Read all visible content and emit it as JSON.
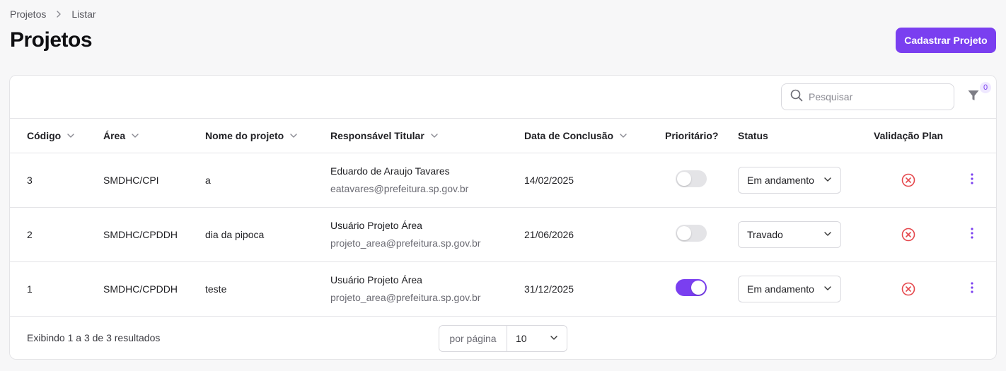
{
  "breadcrumb": {
    "items": [
      "Projetos",
      "Listar"
    ]
  },
  "page": {
    "title": "Projetos"
  },
  "actions": {
    "create_label": "Cadastrar Projeto"
  },
  "search": {
    "placeholder": "Pesquisar",
    "value": ""
  },
  "filter": {
    "count": "0"
  },
  "table": {
    "columns": [
      "Código",
      "Área",
      "Nome do projeto",
      "Responsável Titular",
      "Data de Conclusão",
      "Prioritário?",
      "Status",
      "Validação Plan"
    ],
    "rows": [
      {
        "codigo": "3",
        "area": "SMDHC/CPI",
        "nome": "a",
        "responsavel": "Eduardo de Araujo Tavares",
        "email": "eatavares@prefeitura.sp.gov.br",
        "data": "14/02/2025",
        "prioritario": false,
        "status": "Em andamento"
      },
      {
        "codigo": "2",
        "area": "SMDHC/CPDDH",
        "nome": "dia da pipoca",
        "responsavel": "Usuário Projeto Área",
        "email": "projeto_area@prefeitura.sp.gov.br",
        "data": "21/06/2026",
        "prioritario": false,
        "status": "Travado"
      },
      {
        "codigo": "1",
        "area": "SMDHC/CPDDH",
        "nome": "teste",
        "responsavel": "Usuário Projeto Área",
        "email": "projeto_area@prefeitura.sp.gov.br",
        "data": "31/12/2025",
        "prioritario": true,
        "status": "Em andamento"
      }
    ]
  },
  "pagination": {
    "summary": "Exibindo 1 a 3 de 3 resultados",
    "per_page_label": "por página",
    "per_page_value": "10"
  },
  "colors": {
    "accent": "#7a3ff0",
    "danger": "#e5484d"
  },
  "icons": {
    "breadcrumb_separator": "chevron-right-icon",
    "search": "search-icon",
    "filter": "filter-icon",
    "sort": "chevron-down-icon",
    "validation": "x-circle-icon",
    "more": "more-vertical-icon"
  }
}
